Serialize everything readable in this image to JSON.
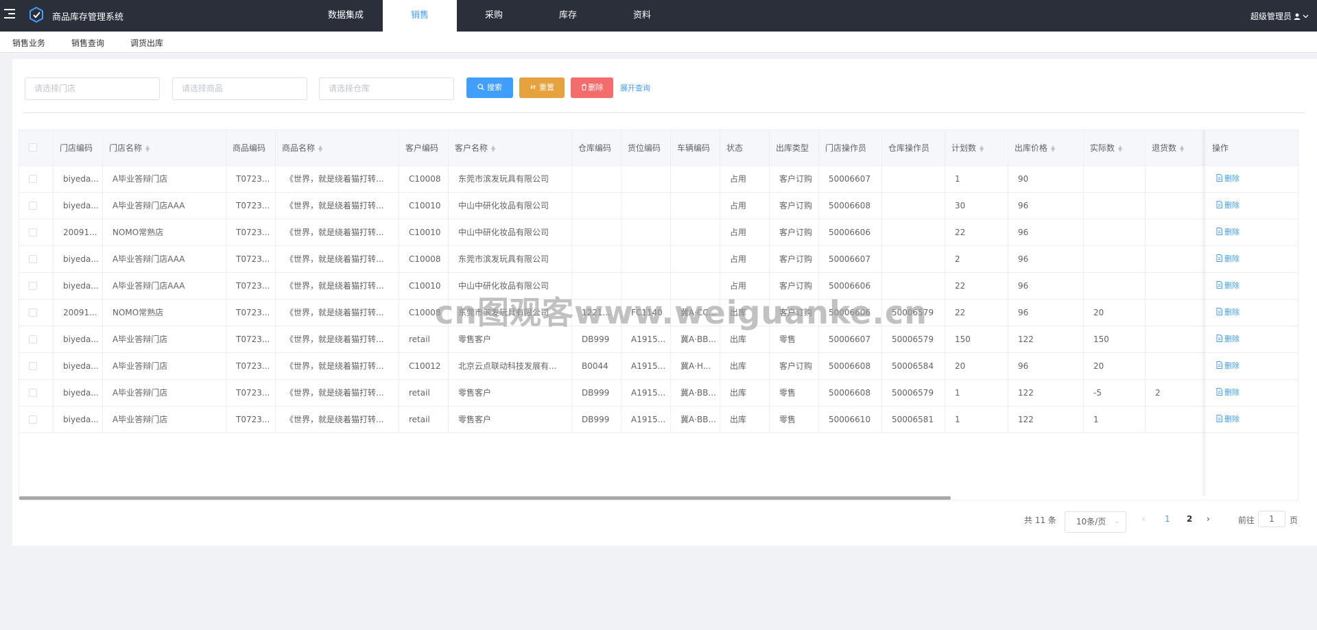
{
  "app": {
    "title": "商品库存管理系统",
    "user": "超级管理员"
  },
  "nav": {
    "items": [
      "数据集成",
      "销售",
      "采购",
      "库存",
      "资料"
    ],
    "active": 1
  },
  "subnav": {
    "items": [
      "销售业务",
      "销售查询",
      "调货出库"
    ]
  },
  "filters": {
    "store_placeholder": "请选择门店",
    "product_placeholder": "请选择商品",
    "warehouse_placeholder": "请选择仓库",
    "search_label": "搜索",
    "reset_label": "重置",
    "delete_label": "删除",
    "expand_label": "展开查询"
  },
  "table": {
    "columns": [
      "门店编码",
      "门店名称",
      "商品编码",
      "商品名称",
      "客户编码",
      "客户名称",
      "仓库编码",
      "货位编码",
      "车辆编码",
      "状态",
      "出库类型",
      "门店操作员",
      "仓库操作员",
      "计划数",
      "出库价格",
      "实际数",
      "退货数"
    ],
    "sortable": [
      false,
      true,
      false,
      true,
      false,
      true,
      false,
      false,
      false,
      false,
      false,
      false,
      false,
      true,
      true,
      true,
      true
    ],
    "op_header": "操作",
    "op_delete": "删除",
    "rows": [
      [
        "biyeda...",
        "A毕业答辩门店",
        "T0723...",
        "《世界，就是绕着猫打转...",
        "C10008",
        "东莞市滨发玩具有限公司",
        "",
        "",
        "",
        "占用",
        "客户订购",
        "50006607",
        "",
        "1",
        "90",
        "",
        ""
      ],
      [
        "biyeda...",
        "A毕业答辩门店AAA",
        "T0723...",
        "《世界，就是绕着猫打转...",
        "C10010",
        "中山中研化妆品有限公司",
        "",
        "",
        "",
        "占用",
        "客户订购",
        "50006608",
        "",
        "30",
        "96",
        "",
        ""
      ],
      [
        "20091...",
        "NOMO常熟店",
        "T0723...",
        "《世界，就是绕着猫打转...",
        "C10010",
        "中山中研化妆品有限公司",
        "",
        "",
        "",
        "占用",
        "客户订购",
        "50006606",
        "",
        "22",
        "96",
        "",
        ""
      ],
      [
        "biyeda...",
        "A毕业答辩门店AAA",
        "T0723...",
        "《世界，就是绕着猫打转...",
        "C10008",
        "东莞市滨发玩具有限公司",
        "",
        "",
        "",
        "占用",
        "客户订购",
        "50006607",
        "",
        "2",
        "96",
        "",
        ""
      ],
      [
        "biyeda...",
        "A毕业答辩门店AAA",
        "T0723...",
        "《世界，就是绕着猫打转...",
        "C10010",
        "中山中研化妆品有限公司",
        "",
        "",
        "",
        "占用",
        "客户订购",
        "50006606",
        "",
        "22",
        "96",
        "",
        ""
      ],
      [
        "20091...",
        "NOMO常熟店",
        "T0723...",
        "《世界，就是绕着猫打转...",
        "C10008",
        "东莞市滨发玩具有限公司",
        "1221...",
        "FC1140",
        "冀A·CC...",
        "出库",
        "客户订购",
        "50006606",
        "50006579",
        "22",
        "96",
        "20",
        ""
      ],
      [
        "biyeda...",
        "A毕业答辩门店",
        "T0723...",
        "《世界，就是绕着猫打转...",
        "retail",
        "零售客户",
        "DB999",
        "A1915...",
        "冀A·BB...",
        "出库",
        "零售",
        "50006607",
        "50006579",
        "150",
        "122",
        "150",
        ""
      ],
      [
        "biyeda...",
        "A毕业答辩门店",
        "T0723...",
        "《世界，就是绕着猫打转...",
        "C10012",
        "北京云点联动科技发展有...",
        "B0044",
        "A1915...",
        "冀A·H...",
        "出库",
        "客户订购",
        "50006608",
        "50006584",
        "20",
        "96",
        "20",
        ""
      ],
      [
        "biyeda...",
        "A毕业答辩门店",
        "T0723...",
        "《世界，就是绕着猫打转...",
        "retail",
        "零售客户",
        "DB999",
        "A1915...",
        "冀A·BB...",
        "出库",
        "零售",
        "50006608",
        "50006579",
        "1",
        "122",
        "-5",
        "2"
      ],
      [
        "biyeda...",
        "A毕业答辩门店",
        "T0723...",
        "《世界，就是绕着猫打转...",
        "retail",
        "零售客户",
        "DB999",
        "A1915...",
        "冀A·BB...",
        "出库",
        "零售",
        "50006610",
        "50006581",
        "1",
        "122",
        "1",
        ""
      ]
    ]
  },
  "pagination": {
    "total": "共 11 条",
    "page_size": "10条/页",
    "pages": [
      "1",
      "2"
    ],
    "current": "1",
    "jump_label": "前往",
    "jump_value": "1",
    "page_suffix": "页",
    "prev": "‹",
    "next": "›"
  },
  "watermark": "cn图观客www.weiguanke.cn",
  "colors": {
    "topbar": "#2b2f3a",
    "primary": "#409eff",
    "warning": "#e6a23c",
    "danger": "#f56c6c"
  }
}
